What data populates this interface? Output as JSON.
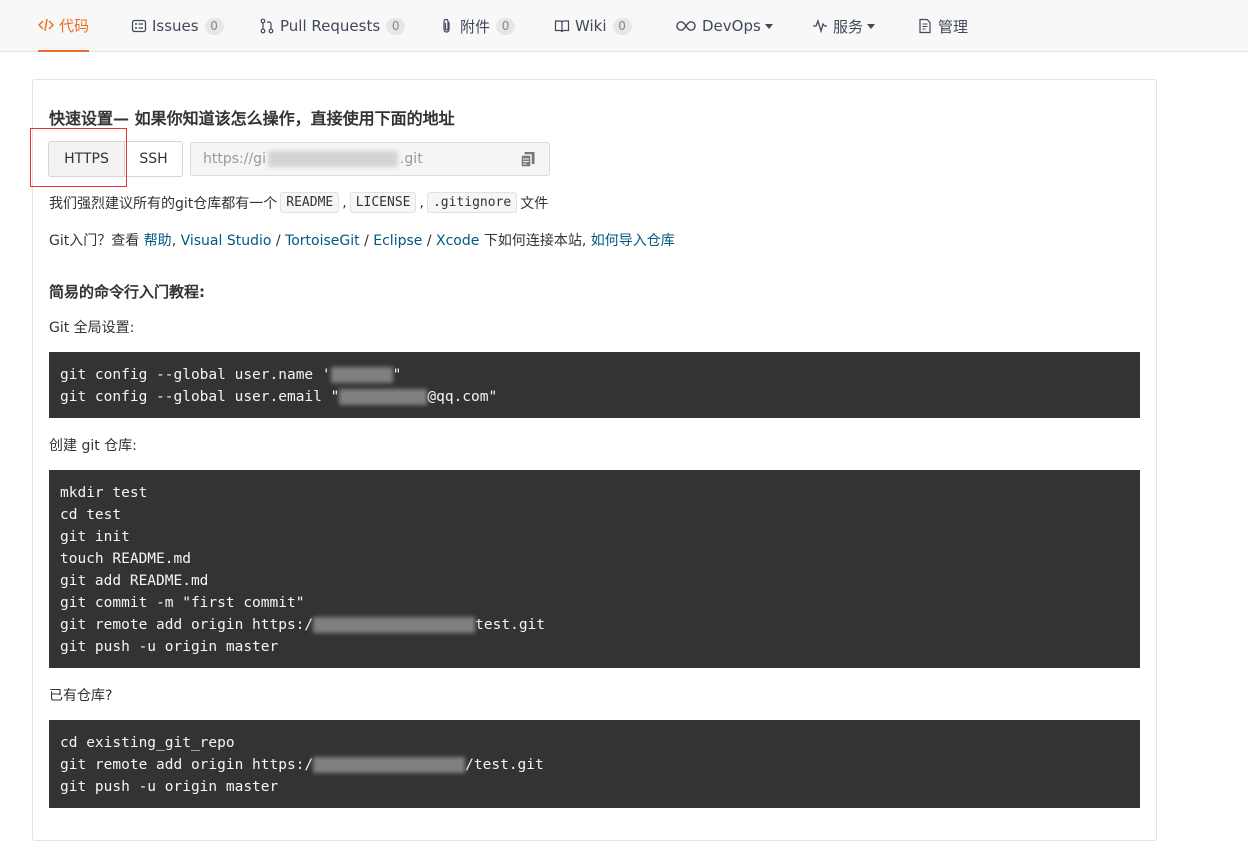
{
  "nav": {
    "tabs": [
      {
        "label": "代码",
        "icon": "code-icon",
        "active": true
      },
      {
        "label": "Issues",
        "icon": "issues-icon",
        "count": "0"
      },
      {
        "label": "Pull Requests",
        "icon": "pull-request-icon",
        "count": "0"
      },
      {
        "label": "附件",
        "icon": "paperclip-icon",
        "count": "0"
      },
      {
        "label": "Wiki",
        "icon": "book-icon",
        "count": "0"
      },
      {
        "label": "DevOps",
        "icon": "infinity-icon",
        "dropdown": true
      },
      {
        "label": "服务",
        "icon": "pulse-icon",
        "dropdown": true
      },
      {
        "label": "管理",
        "icon": "document-settings-icon"
      }
    ]
  },
  "quick_setup": {
    "heading": "快速设置— 如果你知道该怎么操作，直接使用下面的地址",
    "protocols": [
      "HTTPS",
      "SSH"
    ],
    "selected_protocol": "HTTPS",
    "url_prefix": "https://gi",
    "url_suffix": ".git",
    "advice": {
      "before": "我们强烈建议所有的git仓库都有一个",
      "files": [
        "README",
        "LICENSE",
        ".gitignore"
      ],
      "after": "文件"
    },
    "help": {
      "prefix": "Git入门？查看 ",
      "help_link": "帮助",
      "tools": [
        "Visual Studio",
        "TortoiseGit",
        "Eclipse",
        "Xcode"
      ],
      "middle": " 下如何连接本站, ",
      "import_link": "如何导入仓库"
    }
  },
  "tutorial": {
    "heading": "简易的命令行入门教程:",
    "global_label": "Git 全局设置:",
    "global_lines": [
      "git config --global user.name '",
      "\"",
      "git config --global user.email \"",
      "@qq.com\""
    ],
    "create_label": "创建 git 仓库:",
    "create_lines": [
      "mkdir test",
      "cd test",
      "git init",
      "touch README.md",
      "git add README.md",
      "git commit -m \"first commit\"",
      "git remote add origin https:/",
      "test.git",
      "git push -u origin master"
    ],
    "existing_label": "已有仓库?",
    "existing_lines": [
      "cd existing_git_repo",
      "git remote add origin https:/",
      "/test.git",
      "git push -u origin master"
    ]
  }
}
